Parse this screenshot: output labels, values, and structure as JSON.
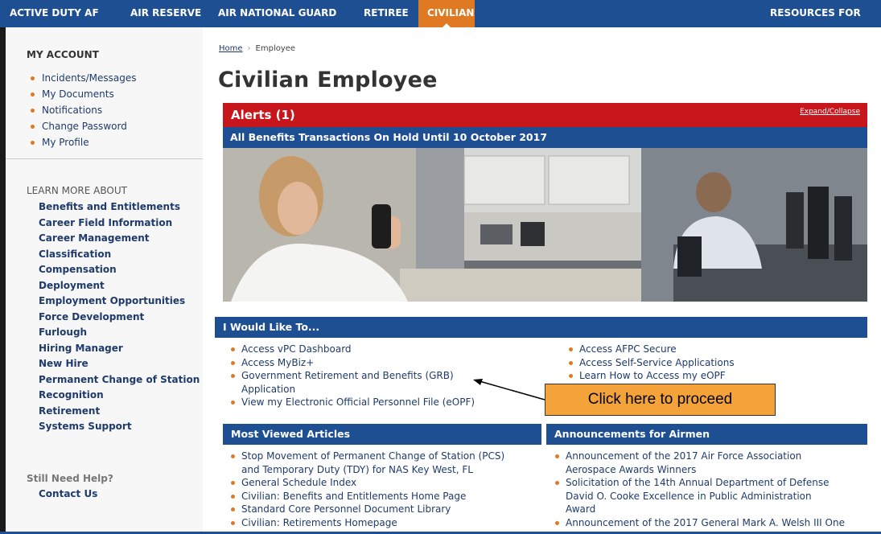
{
  "topnav": {
    "items": [
      "ACTIVE DUTY AF",
      "AIR RESERVE",
      "AIR NATIONAL GUARD",
      "RETIREE",
      "CIVILIAN"
    ],
    "right_label": "RESOURCES FOR FSS",
    "active": "CIVILIAN"
  },
  "sidebar": {
    "account_heading": "MY ACCOUNT",
    "account_items": [
      "Incidents/Messages",
      "My Documents",
      "Notifications",
      "Change Password",
      "My Profile"
    ],
    "learn_heading": "LEARN MORE ABOUT",
    "learn_items": [
      "Benefits and Entitlements",
      "Career Field Information",
      "Career Management",
      "Classification",
      "Compensation",
      "Deployment",
      "Employment Opportunities",
      "Force Development",
      "Furlough",
      "Hiring Manager",
      "New Hire",
      "Permanent Change of Station",
      "Recognition",
      "Retirement",
      "Systems Support"
    ],
    "help_heading": "Still Need Help?",
    "help_link": "Contact Us"
  },
  "breadcrumb": {
    "home": "Home",
    "separator": "›",
    "current": "Employee"
  },
  "page_title": "Civilian Employee",
  "alerts": {
    "title": "Alerts (1)",
    "toggle": "Expand/Collapse",
    "message": "All Benefits Transactions On Hold Until 10 October 2017"
  },
  "i_would_like": {
    "title": "I Would Like To...",
    "left_items": [
      "Access vPC Dashboard",
      "Access MyBiz+",
      "Government Retirement and Benefits (GRB)",
      "View my Electronic Official Personnel File (eOPF)"
    ],
    "grb_continuation": "Application",
    "right_items": [
      "Access AFPC Secure",
      "Access Self-Service Applications",
      "Learn How to Access my eOPF"
    ]
  },
  "callout": "Click here to proceed",
  "most_viewed": {
    "title": "Most Viewed Articles",
    "items": [
      {
        "line1": "Stop Movement of Permanent Change of Station (PCS)",
        "line2": "and Temporary Duty (TDY) for NAS Key West, FL"
      },
      {
        "line1": "General Schedule Index"
      },
      {
        "line1": "Civilian: Benefits and Entitlements Home Page"
      },
      {
        "line1": "Standard Core Personnel Document Library"
      },
      {
        "line1": "Civilian: Retirements Homepage"
      }
    ]
  },
  "announcements": {
    "title": "Announcements for Airmen",
    "items": [
      {
        "line1": "Announcement of the 2017 Air Force Association",
        "line2": "Aerospace Awards Winners"
      },
      {
        "line1": "Solicitation of the 14th Annual Department of Defense",
        "line2": "David O. Cooke Excellence in Public Administration",
        "line3": "Award"
      },
      {
        "line1": "Announcement of the 2017 General Mark A. Welsh III One"
      }
    ]
  },
  "colors": {
    "nav_blue": "#1f4f93",
    "active_orange": "#e07a22",
    "alert_red": "#c8161d",
    "callout_orange": "#f4a33a"
  }
}
